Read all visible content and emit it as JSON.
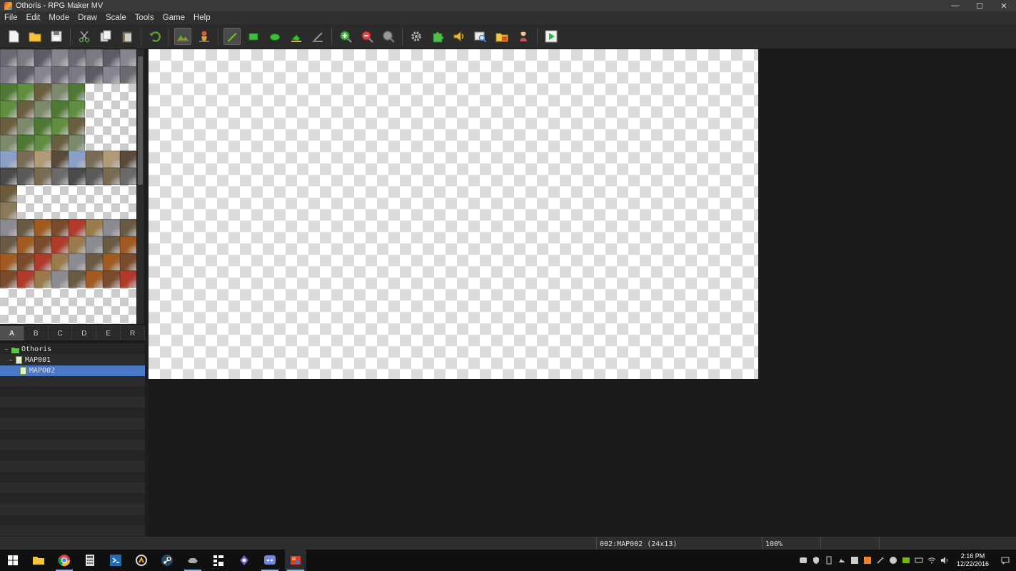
{
  "window": {
    "title": "Othoris - RPG Maker MV",
    "minimize_glyph": "—",
    "maximize_glyph": "☐",
    "close_glyph": "✕"
  },
  "menu": [
    "File",
    "Edit",
    "Mode",
    "Draw",
    "Scale",
    "Tools",
    "Game",
    "Help"
  ],
  "tile_tabs": [
    "A",
    "B",
    "C",
    "D",
    "E",
    "R"
  ],
  "map_tree": {
    "project": "Othoris",
    "maps": [
      {
        "name": "MAP001",
        "depth": 1,
        "expander": "−"
      },
      {
        "name": "MAP002",
        "depth": 2,
        "selected": true
      }
    ]
  },
  "status": {
    "map_info": "002:MAP002 (24x13)",
    "zoom": "100%"
  },
  "taskbar": {
    "time": "2:16 PM",
    "date": "12/22/2016"
  },
  "colors": {
    "selection": "#4a78c6",
    "play": "#2db84b",
    "accent": "#8ab4e6"
  }
}
